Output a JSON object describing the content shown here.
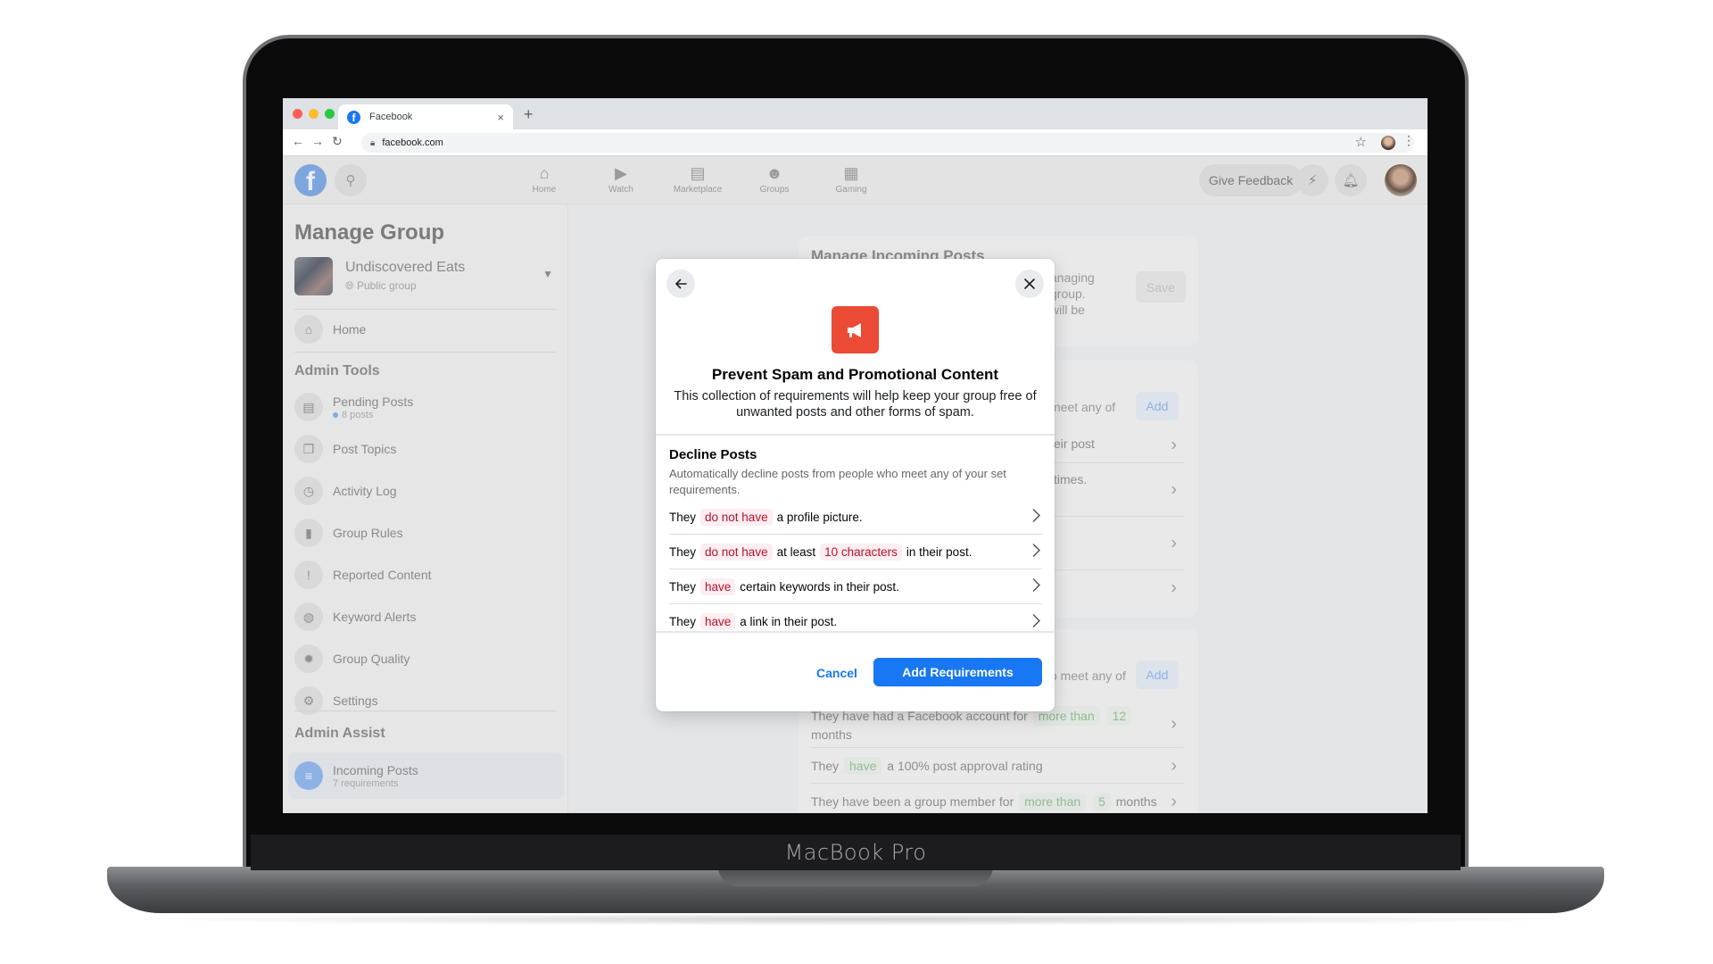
{
  "device": {
    "label": "MacBook Pro"
  },
  "browser": {
    "tab_title": "Facebook",
    "tab_close": "×",
    "new_tab": "+",
    "url": "facebook.com",
    "traffic_lights": [
      "#fe5f57",
      "#febc2e",
      "#28c840"
    ]
  },
  "header": {
    "nav": [
      {
        "label": "Home",
        "icon": "home-icon",
        "glyph": "⌂"
      },
      {
        "label": "Watch",
        "icon": "watch-icon",
        "glyph": "▶"
      },
      {
        "label": "Marketplace",
        "icon": "marketplace-icon",
        "glyph": "▤"
      },
      {
        "label": "Groups",
        "icon": "groups-icon",
        "glyph": "☻"
      },
      {
        "label": "Gaming",
        "icon": "gaming-icon",
        "glyph": "▦"
      }
    ],
    "feedback_label": "Give Feedback"
  },
  "sidebar": {
    "title": "Manage Group",
    "group": {
      "name": "Undiscovered Eats",
      "privacy": "Public group"
    },
    "home_label": "Home",
    "admin_tools_heading": "Admin Tools",
    "admin_tools": [
      {
        "label": "Pending Posts",
        "sub": "8 posts",
        "icon": "pending-posts-icon",
        "glyph": "▤"
      },
      {
        "label": "Post Topics",
        "icon": "post-topics-icon",
        "glyph": "❐"
      },
      {
        "label": "Activity Log",
        "icon": "activity-log-icon",
        "glyph": "◷"
      },
      {
        "label": "Group Rules",
        "icon": "group-rules-icon",
        "glyph": "▮"
      },
      {
        "label": "Reported Content",
        "icon": "reported-content-icon",
        "glyph": "!"
      },
      {
        "label": "Keyword Alerts",
        "icon": "keyword-alerts-icon",
        "glyph": "◍"
      },
      {
        "label": "Group Quality",
        "icon": "group-quality-icon",
        "glyph": "✹"
      },
      {
        "label": "Settings",
        "icon": "settings-icon",
        "glyph": "⚙"
      }
    ],
    "admin_assist_heading": "Admin Assist",
    "admin_assist": [
      {
        "label": "Incoming Posts",
        "sub": "7 requirements"
      }
    ]
  },
  "background": {
    "card1": {
      "title": "Manage Incoming Posts",
      "text_lines": [
        "anaging",
        "group.",
        "will be"
      ],
      "save_label": "Save"
    },
    "card2": {
      "partial": "meet any of",
      "add_label": "Add",
      "rows": [
        "eir post",
        "times.",
        "",
        ""
      ]
    },
    "card3": {
      "partial": "o meet any of",
      "add_label": "Add",
      "rows": [
        {
          "pre": "They have had a Facebook account for",
          "tag1": "more than",
          "tag2": "12",
          "post": "months"
        },
        {
          "pre": "They",
          "tag1": "have",
          "post": "a 100% post approval rating"
        },
        {
          "pre": "They have been a group member for",
          "tag1": "more than",
          "tag2": "5",
          "post": "months"
        }
      ]
    }
  },
  "modal": {
    "title": "Prevent Spam and Promotional Content",
    "description": "This collection of requirements will help keep your group free of unwanted posts and other forms of spam.",
    "section_title": "Decline Posts",
    "section_description": "Automatically decline posts from people who meet any of your set requirements.",
    "rules": [
      {
        "pre": "They",
        "tag1": "do not have",
        "mid": "a profile picture.",
        "tag2": null,
        "post": ""
      },
      {
        "pre": "They",
        "tag1": "do not have",
        "mid": "at least",
        "tag2": "10 characters",
        "post": "in their post."
      },
      {
        "pre": "They",
        "tag1": "have",
        "mid": "certain keywords in their post.",
        "tag2": null,
        "post": ""
      },
      {
        "pre": "They",
        "tag1": "have",
        "mid": "a link in their post.",
        "tag2": null,
        "post": ""
      }
    ],
    "cancel_label": "Cancel",
    "primary_label": "Add Requirements",
    "icon_color": "#eb4a34",
    "primary_color": "#1877f2"
  }
}
